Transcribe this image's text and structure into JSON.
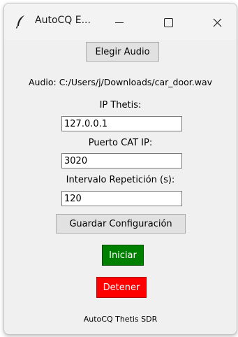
{
  "window": {
    "title": "AutoCQ E...",
    "app_icon": "feather-icon"
  },
  "controls": {
    "choose_audio_button": "Elegir Audio",
    "audio_path": "Audio: C:/Users/j/Downloads/car_door.wav",
    "ip_label": "IP Thetis:",
    "ip_value": "127.0.0.1",
    "port_label": "Puerto CAT IP:",
    "port_value": "3020",
    "interval_label": "Intervalo Repetición (s):",
    "interval_value": "120",
    "save_button": "Guardar Configuración",
    "start_button": "Iniciar",
    "stop_button": "Detener"
  },
  "footer": "AutoCQ Thetis SDR",
  "colors": {
    "start_bg": "#008000",
    "stop_bg": "#ff0000",
    "window_bg": "#f0f0f0"
  }
}
